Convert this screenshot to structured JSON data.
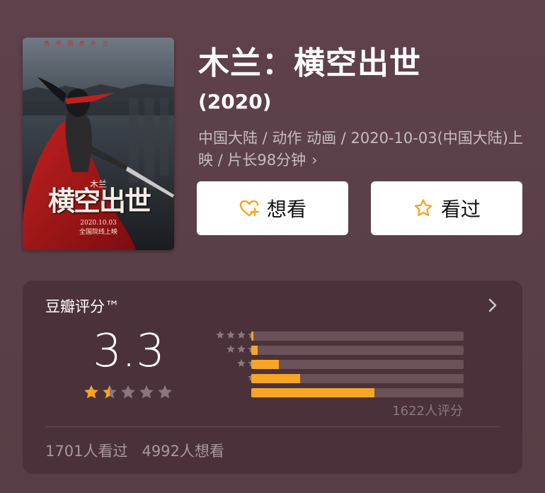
{
  "movie": {
    "title": "木兰：横空出世",
    "year": "(2020)",
    "meta": "中国大陆 / 动作 动画 / 2020-10-03(中国大陆)上映 / 片长98分钟",
    "meta_arrow": "›"
  },
  "poster": {
    "top_text": "真 中 國   真 木 兰",
    "small_title": "木兰",
    "headline": "横空出世",
    "date": "2020.10.03",
    "release_note": "全国院线上映"
  },
  "actions": {
    "want_label": "想看",
    "seen_label": "看过"
  },
  "rating": {
    "header": "豆瓣评分™",
    "score": "3.3",
    "stars_filled": 1.5,
    "distribution": [
      {
        "stars": 5,
        "percent": 1
      },
      {
        "stars": 4,
        "percent": 3
      },
      {
        "stars": 3,
        "percent": 13
      },
      {
        "stars": 2,
        "percent": 23
      },
      {
        "stars": 1,
        "percent": 58
      }
    ],
    "count_text": "1622人评分",
    "seen_text": "1701人看过",
    "want_text": "4992人想看"
  },
  "colors": {
    "background": "#5a3f48",
    "card": "#4b3139",
    "accent": "#f6a623",
    "track": "#6b5158",
    "star_empty": "#8a767c"
  },
  "icons": {
    "want": "heart-plus-icon",
    "seen": "star-outline-icon",
    "chevron": "chevron-right-icon"
  }
}
